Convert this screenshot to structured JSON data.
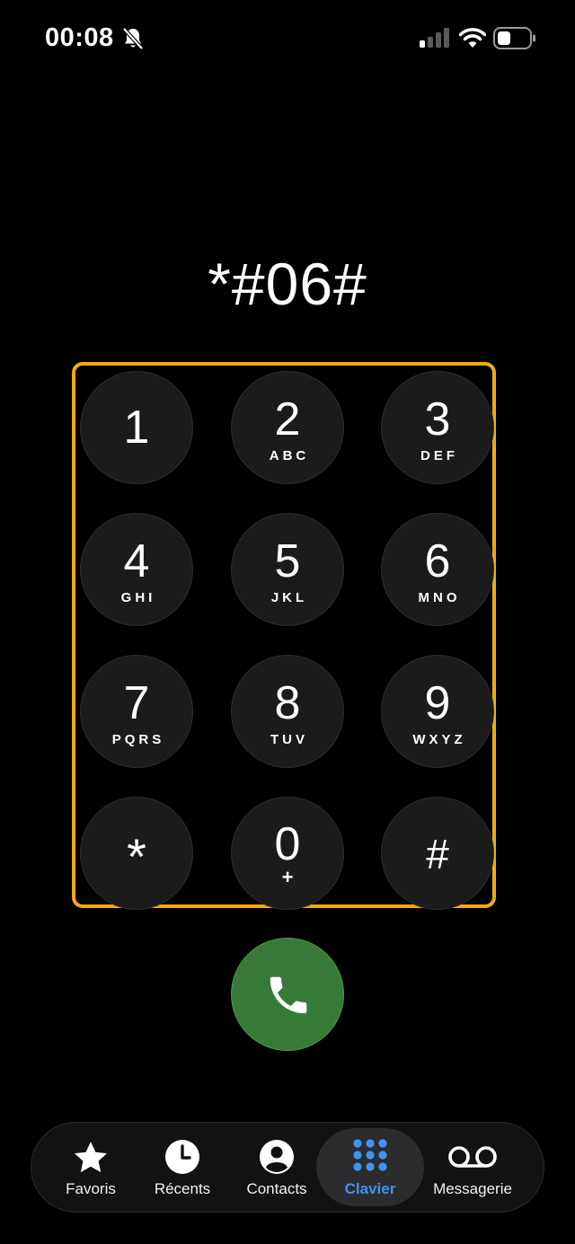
{
  "status_bar": {
    "time": "00:08",
    "icons": [
      "bell-slash-icon",
      "cellular-signal-icon",
      "wifi-icon",
      "battery-icon"
    ]
  },
  "dialer": {
    "number": "*#06#"
  },
  "keypad": {
    "highlight_color": "#f0ab14",
    "keys": [
      {
        "digit": "1",
        "letters": ""
      },
      {
        "digit": "2",
        "letters": "ABC"
      },
      {
        "digit": "3",
        "letters": "DEF"
      },
      {
        "digit": "4",
        "letters": "GHI"
      },
      {
        "digit": "5",
        "letters": "JKL"
      },
      {
        "digit": "6",
        "letters": "MNO"
      },
      {
        "digit": "7",
        "letters": "PQRS"
      },
      {
        "digit": "8",
        "letters": "TUV"
      },
      {
        "digit": "9",
        "letters": "WXYZ"
      },
      {
        "digit": "*",
        "letters": ""
      },
      {
        "digit": "0",
        "letters": "+"
      },
      {
        "digit": "#",
        "letters": ""
      }
    ]
  },
  "call_button": {
    "icon": "phone-icon",
    "color": "#377a37"
  },
  "tab_bar": {
    "active_color": "#3f93f5",
    "tabs": [
      {
        "label": "Favoris",
        "icon": "star-icon"
      },
      {
        "label": "Récents",
        "icon": "clock-icon"
      },
      {
        "label": "Contacts",
        "icon": "person-circle-icon"
      },
      {
        "label": "Clavier",
        "icon": "keypad-grid-icon",
        "active": true
      },
      {
        "label": "Messagerie",
        "icon": "voicemail-icon"
      }
    ]
  }
}
